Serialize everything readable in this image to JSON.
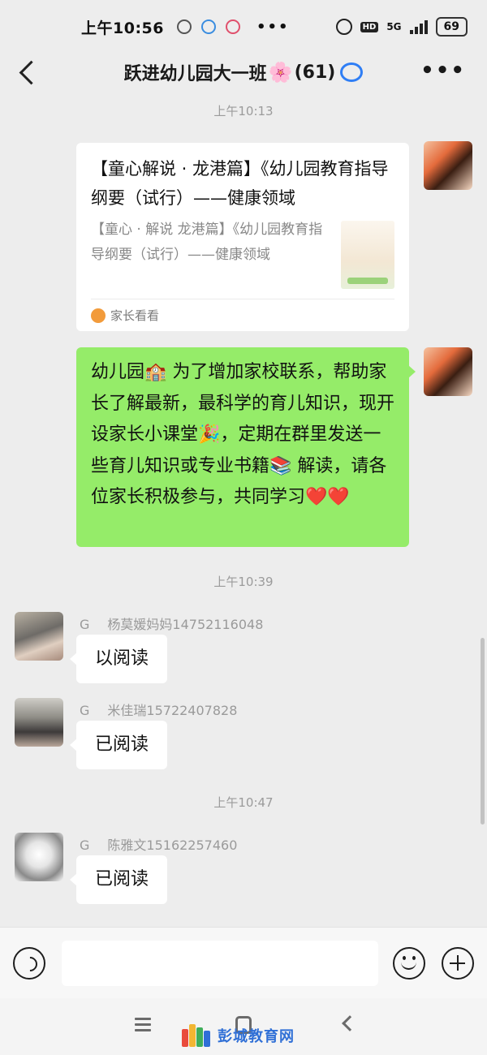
{
  "status_bar": {
    "time": "上午10:56",
    "dots": "•••",
    "hd": "HD",
    "network": "5G",
    "battery": "69"
  },
  "header": {
    "title_main": "跃进幼儿园大一班",
    "flower": "🌸",
    "member_count": "(61)",
    "more": "•••"
  },
  "messages": {
    "time1": "上午10:13",
    "card": {
      "title": "【童心解说 · 龙港篇】《幼儿园教育指导纲要（试行）——健康领域",
      "desc": "【童心 · 解说 龙港篇】《幼儿园教育指导纲要（试行）——健康领域",
      "source": "家长看看"
    },
    "announcement": "幼儿园🏫 为了增加家校联系，帮助家长了解最新，最科学的育儿知识，现开设家长小课堂🎉，定期在群里发送一些育儿知识或专业书籍📚 解读，请各位家长积极参与，共同学习❤️❤️",
    "time2": "上午10:39",
    "msg1": {
      "tag": "G",
      "sender": "杨莫媛妈妈14752116048",
      "text": "以阅读"
    },
    "msg2": {
      "tag": "G",
      "sender": "米佳瑞15722407828",
      "text": "已阅读"
    },
    "time3": "上午10:47",
    "msg3": {
      "tag": "G",
      "sender": "陈雅文15162257460",
      "text": "已阅读"
    }
  },
  "input": {
    "value": ""
  },
  "watermark": {
    "text": "彭城教育网"
  },
  "colors": {
    "background": "#ededed",
    "sent_bubble": "#95ec69",
    "received_bubble": "#ffffff",
    "watermark_blue": "#2f6fd6"
  }
}
